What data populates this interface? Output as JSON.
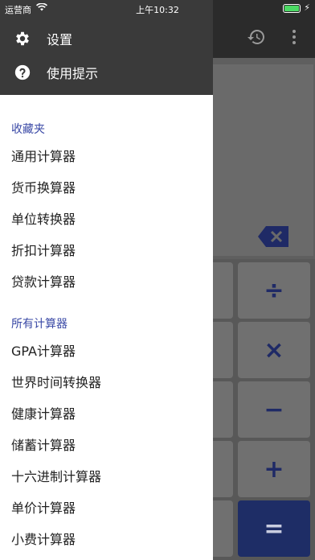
{
  "status_bar": {
    "carrier": "运营商",
    "time": "上午10:32"
  },
  "drawer": {
    "header": {
      "settings_label": "设置",
      "tips_label": "使用提示"
    },
    "favorites": {
      "title": "收藏夹",
      "items": [
        "通用计算器",
        "货币换算器",
        "单位转换器",
        "折扣计算器",
        "贷款计算器"
      ]
    },
    "all": {
      "title": "所有计算器",
      "items": [
        "GPA计算器",
        "世界时间转换器",
        "健康计算器",
        "储蓄计算器",
        "十六进制计算器",
        "单价计算器",
        "小费计算器"
      ]
    }
  },
  "calculator": {
    "keys": [
      "÷",
      "×",
      "−",
      "+",
      "="
    ]
  },
  "colors": {
    "section_title": "#3a49a6",
    "drawer_header": "#3a3a3a",
    "equals_key": "#1e2d66"
  }
}
